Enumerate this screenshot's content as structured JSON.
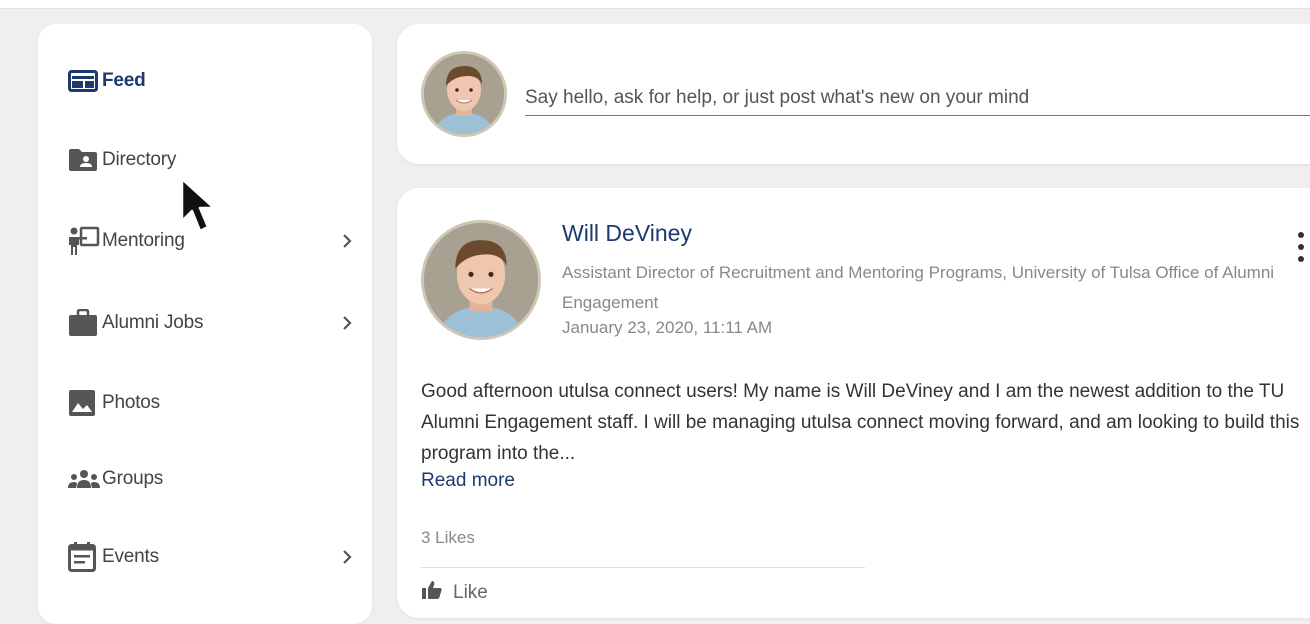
{
  "sidebar": {
    "items": [
      {
        "label": "Feed",
        "icon": "feed-icon",
        "has_chevron": false
      },
      {
        "label": "Directory",
        "icon": "directory-folder-icon",
        "has_chevron": false
      },
      {
        "label": "Mentoring",
        "icon": "mentoring-presenter-icon",
        "has_chevron": true
      },
      {
        "label": "Alumni Jobs",
        "icon": "briefcase-icon",
        "has_chevron": true
      },
      {
        "label": "Photos",
        "icon": "photo-icon",
        "has_chevron": false
      },
      {
        "label": "Groups",
        "icon": "groups-people-icon",
        "has_chevron": false
      },
      {
        "label": "Events",
        "icon": "calendar-icon",
        "has_chevron": true
      }
    ]
  },
  "composer": {
    "placeholder": "Say hello, ask for help, or just post what's new on your mind"
  },
  "post": {
    "author_name": "Will DeViney",
    "author_title": "Assistant Director of Recruitment and Mentoring Programs, University of Tulsa Office of Alumni Engagement",
    "date": "January 23, 2020, 11:11 AM",
    "body": "Good afternoon utulsa connect users! My name is Will DeViney and I am the newest addition to the TU Alumni Engagement staff. I will be managing utulsa connect moving forward, and am looking to build this program into the...",
    "read_more": "Read more",
    "likes": "3 Likes",
    "like_action": "Like"
  },
  "colors": {
    "accent": "#1c3a6e",
    "background": "#efefef",
    "card": "#ffffff",
    "muted_text": "#888888"
  }
}
